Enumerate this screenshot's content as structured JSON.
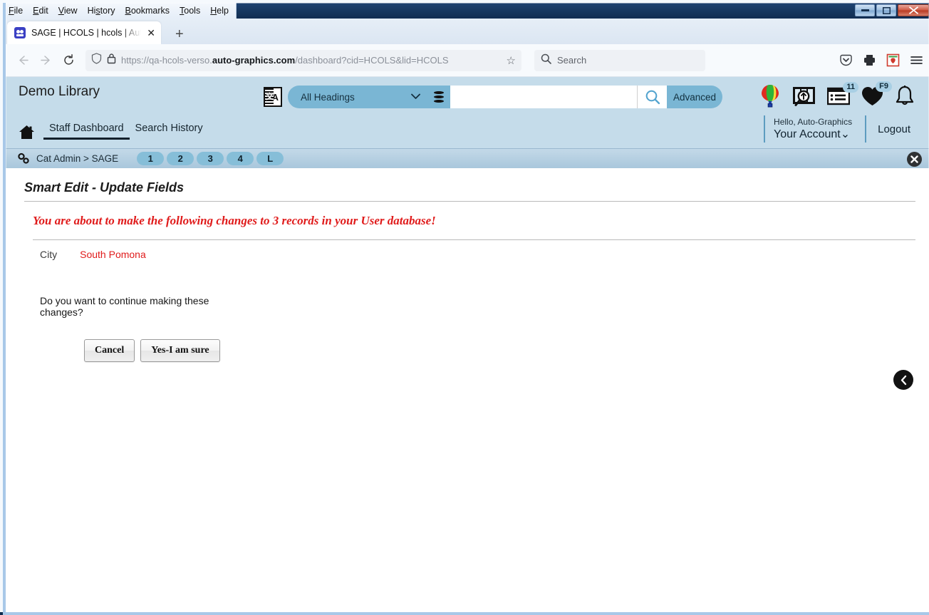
{
  "browser": {
    "menus": [
      "File",
      "Edit",
      "View",
      "History",
      "Bookmarks",
      "Tools",
      "Help"
    ],
    "window_controls": {
      "minimize": "–",
      "maximize": "□",
      "close": "✕"
    },
    "tab": {
      "title": "SAGE | HCOLS | hcols | Auto-Graphics",
      "close_label": "✕",
      "favicon": "sage-favicon"
    },
    "new_tab_label": "+",
    "back_label": "←",
    "forward_label": "→",
    "reload_label": "↻",
    "url": {
      "prefix": "https://qa-hcols-verso.",
      "domain": "auto-graphics.com",
      "suffix": "/dashboard?cid=HCOLS&lid=HCOLS"
    },
    "bookmark_label": "☆",
    "search": {
      "placeholder": "Search"
    },
    "toolbar_icons": [
      "pocket-icon",
      "print-icon",
      "extension-icon",
      "menu-icon"
    ]
  },
  "app": {
    "title": "Demo Library",
    "search": {
      "translate_icon": "translate-icon",
      "heading_label": "All Headings",
      "database_icon": "database-icon",
      "input_value": "",
      "input_placeholder": "",
      "search_icon": "search-icon",
      "advanced_label": "Advanced"
    },
    "header_icons": [
      {
        "name": "balloon-icon",
        "badge": ""
      },
      {
        "name": "image-search-icon",
        "badge": ""
      },
      {
        "name": "list-icon",
        "badge": "11"
      },
      {
        "name": "heart-icon",
        "badge": "F9"
      },
      {
        "name": "bell-icon",
        "badge": ""
      }
    ],
    "nav_tabs": [
      {
        "label": "Staff Dashboard",
        "active": true
      },
      {
        "label": "Search History",
        "active": false
      }
    ],
    "account": {
      "hello": "Hello, Auto-Graphics",
      "name": "Your Account",
      "chevron": "⌄",
      "logout": "Logout"
    },
    "breadcrumb": {
      "link_icon": "link-icon",
      "text": "Cat Admin > SAGE",
      "pills": [
        "1",
        "2",
        "3",
        "4",
        "L"
      ],
      "close_label": "✕"
    }
  },
  "content": {
    "page_title": "Smart Edit - Update Fields",
    "warning": "You are about to make the following changes to 3 records in your User database!",
    "field": {
      "label": "City",
      "value": "South Pomona"
    },
    "confirm_question": "Do you want to continue making these changes?",
    "buttons": {
      "cancel": "Cancel",
      "confirm": "Yes-I am sure"
    },
    "back_label": "‹"
  },
  "colors": {
    "app_header_bg": "#c5dcea",
    "accent_blue": "#7ab6d4",
    "warning_red": "#e01b1b",
    "crumb_bg": "#a9c7dc"
  }
}
